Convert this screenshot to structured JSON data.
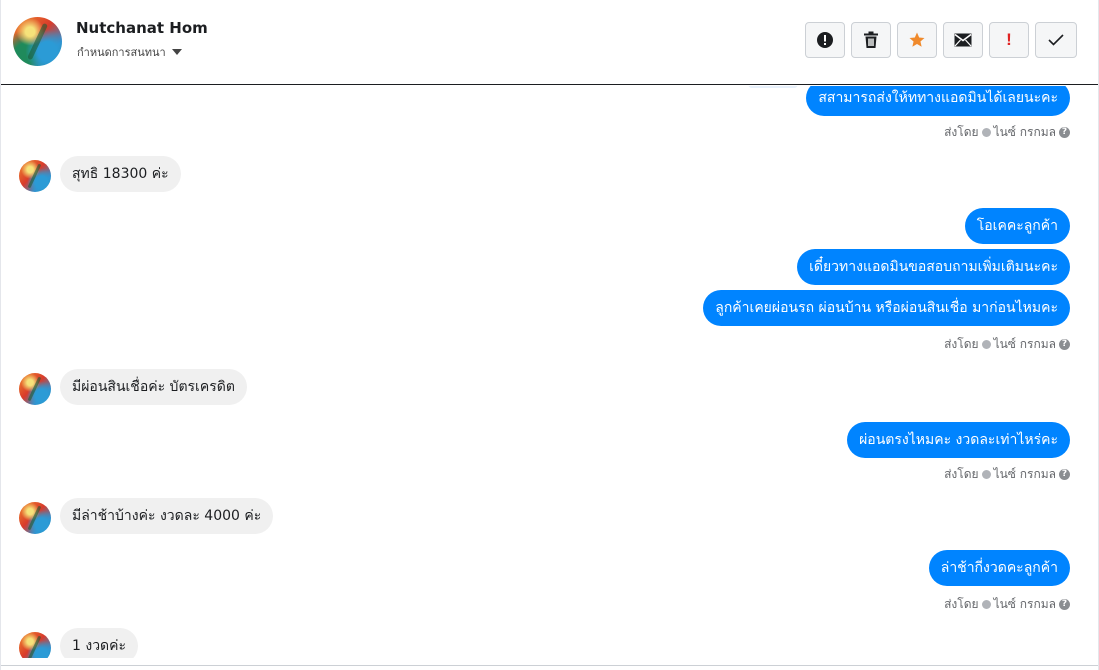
{
  "header": {
    "contact_name": "Nutchanat Hom",
    "conversation_label": "กำหนดการสนทนา",
    "toolbar": {
      "buttons": [
        "alert-circle-icon",
        "trash-icon",
        "star-icon",
        "mail-icon",
        "exclamation-icon",
        "check-icon"
      ],
      "exclamation_text": "!",
      "star_color": "#f08a2c",
      "exclamation_color": "#e02424"
    }
  },
  "thread": {
    "outgoing_color": "#0084ff",
    "incoming_color": "#f0f0f0",
    "messages": {
      "m0": "สสามารถส่งให้ททางแอดมินได้เลยนะคะ",
      "m1": "สุทธิ 18300 ค่ะ",
      "m2": "โอเคคะลูกค้า",
      "m3": "เดี๋ยวทางแอดมินขอสอบถามเพิ่มเติมนะคะ",
      "m4": "ลูกค้าเคยผ่อนรถ ผ่อนบ้าน หรือผ่อนสินเชื่อ มาก่อนไหมคะ",
      "m5": "มีผ่อนสินเชื่อค่ะ บัตรเครดิต",
      "m6": "ผ่อนตรงไหมคะ งวดละเท่าไหร่คะ",
      "m7": "มีล่าช้าบ้างค่ะ งวดละ 4000 ค่ะ",
      "m8": "ล่าช้ากี่งวดคะลูกค้า",
      "m9": "1 งวดค่ะ"
    },
    "sent_by": {
      "prefix": "ส่งโดย",
      "name": "ไนซ์ กรกมล"
    }
  }
}
